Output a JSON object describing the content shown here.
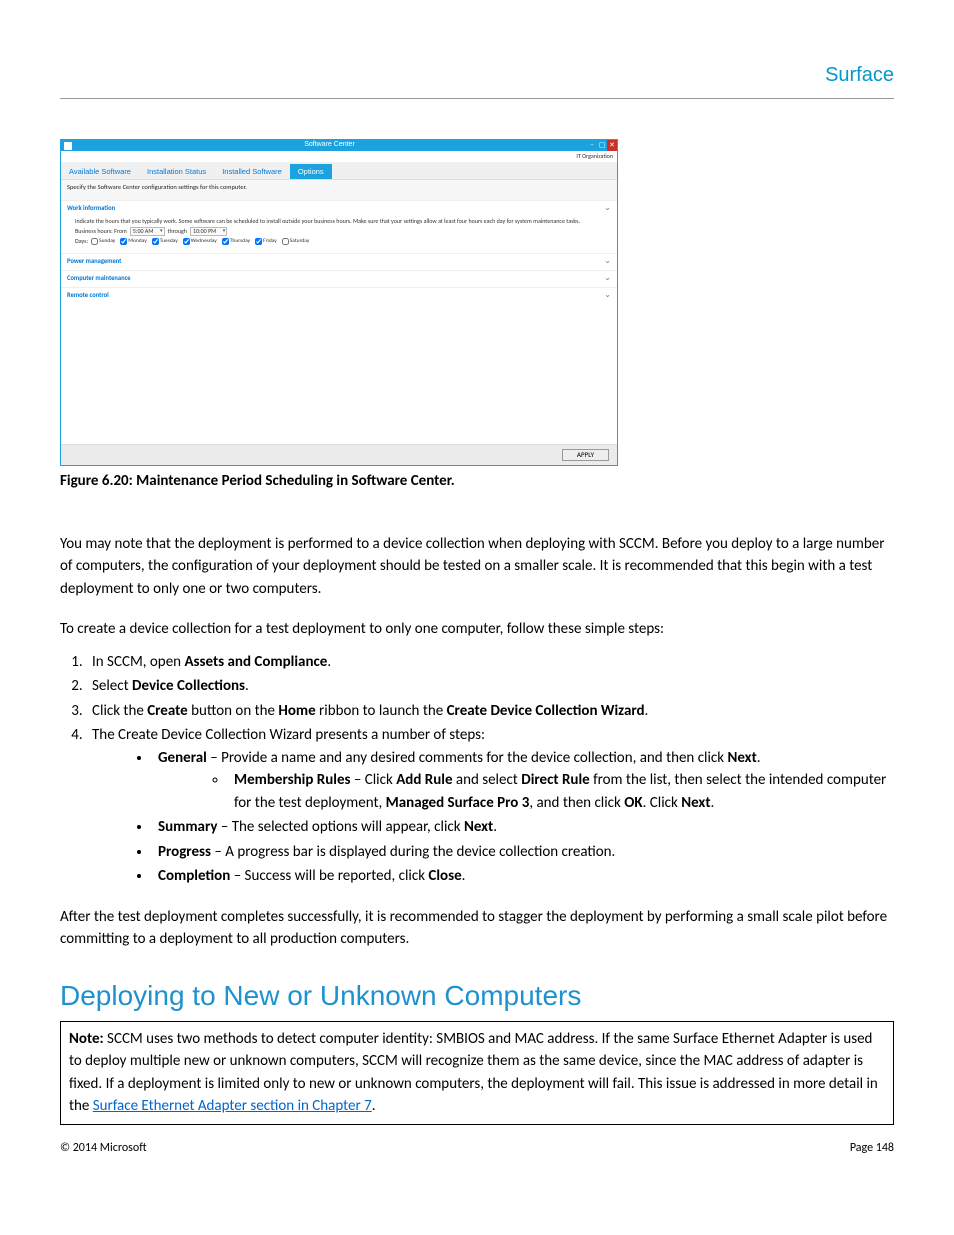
{
  "header": {
    "brand": "Surface"
  },
  "screenshot": {
    "title": "Software Center",
    "org": "IT Organization",
    "tabs": [
      "Available Software",
      "Installation Status",
      "Installed Software",
      "Options"
    ],
    "active_tab_index": 3,
    "instruction": "Specify the Software Center configuration settings for this computer.",
    "work_info": {
      "title": "Work information",
      "desc": "Indicate the hours that you typically work. Some software can be scheduled to install outside your business hours. Make sure that your settings allow at least four hours each day for system maintenance tasks.",
      "hours_label": "Business hours: From",
      "from": "5:00 AM",
      "through_label": "through",
      "to": "10:00 PM",
      "days_label": "Days:",
      "days": [
        "Sunday",
        "Monday",
        "Tuesday",
        "Wednesday",
        "Thursday",
        "Friday",
        "Saturday"
      ],
      "days_checked": [
        false,
        true,
        true,
        true,
        true,
        true,
        false
      ]
    },
    "collapsed_sections": [
      "Power management",
      "Computer maintenance",
      "Remote control"
    ],
    "apply_label": "APPLY"
  },
  "figure_caption": "Figure 6.20: Maintenance Period Scheduling in Software Center.",
  "p1": "You may note that the deployment is performed to a device collection when deploying with SCCM. Before you deploy to a large number of computers, the configuration of your deployment should be tested on a smaller scale. It is recommended that this begin with a test deployment to only one or two computers.",
  "p2": "To create a device collection for a test deployment to only one computer, follow these simple steps:",
  "step1_a": "In SCCM, open ",
  "step1_b": "Assets and Compliance",
  "step1_c": ".",
  "step2_a": "Select ",
  "step2_b": "Device Collections",
  "step2_c": ".",
  "step3_a": "Click the ",
  "step3_b": "Create",
  "step3_c": " button on the ",
  "step3_d": "Home",
  "step3_e": " ribbon to launch the ",
  "step3_f": "Create Device Collection Wizard",
  "step3_g": ".",
  "step4": "The Create Device Collection Wizard presents a number of steps:",
  "b1_a": "General",
  "b1_b": " – Provide a name and any desired comments for the device collection, and then click ",
  "b1_c": "Next",
  "b1_d": ".",
  "sb1_a": "Membership Rules",
  "sb1_b": " – Click ",
  "sb1_c": "Add Rule",
  "sb1_d": " and select ",
  "sb1_e": "Direct Rule",
  "sb1_f": " from the list, then select the intended computer for the test deployment, ",
  "sb1_g": "Managed Surface Pro 3",
  "sb1_h": ", and then click ",
  "sb1_i": "OK",
  "sb1_j": ". Click ",
  "sb1_k": "Next",
  "sb1_l": ".",
  "b2_a": "Summary",
  "b2_b": " – The selected options will appear, click ",
  "b2_c": "Next",
  "b2_d": ".",
  "b3_a": "Progress",
  "b3_b": " – A progress bar is displayed during the device collection creation.",
  "b4_a": "Completion",
  "b4_b": " – Success will be reported, click ",
  "b4_c": "Close",
  "b4_d": ".",
  "p3": "After the test deployment completes successfully, it is recommended to stagger the deployment by performing a small scale pilot before committing to a deployment to all production computers.",
  "heading": "Deploying to New or Unknown Computers",
  "note_label": "Note:",
  "note_body_a": " SCCM uses two methods to detect computer identity: SMBIOS and MAC address. If the same Surface Ethernet Adapter is used to deploy multiple new or unknown computers, SCCM will recognize them as the same device, since the MAC address of adapter is fixed. If a deployment is limited only to new or unknown computers, the deployment will fail. This issue is addressed in more detail in the ",
  "note_link": "Surface Ethernet Adapter section in Chapter 7",
  "note_body_b": ".",
  "footer": {
    "copyright": "© 2014 Microsoft",
    "page": "Page 148"
  }
}
